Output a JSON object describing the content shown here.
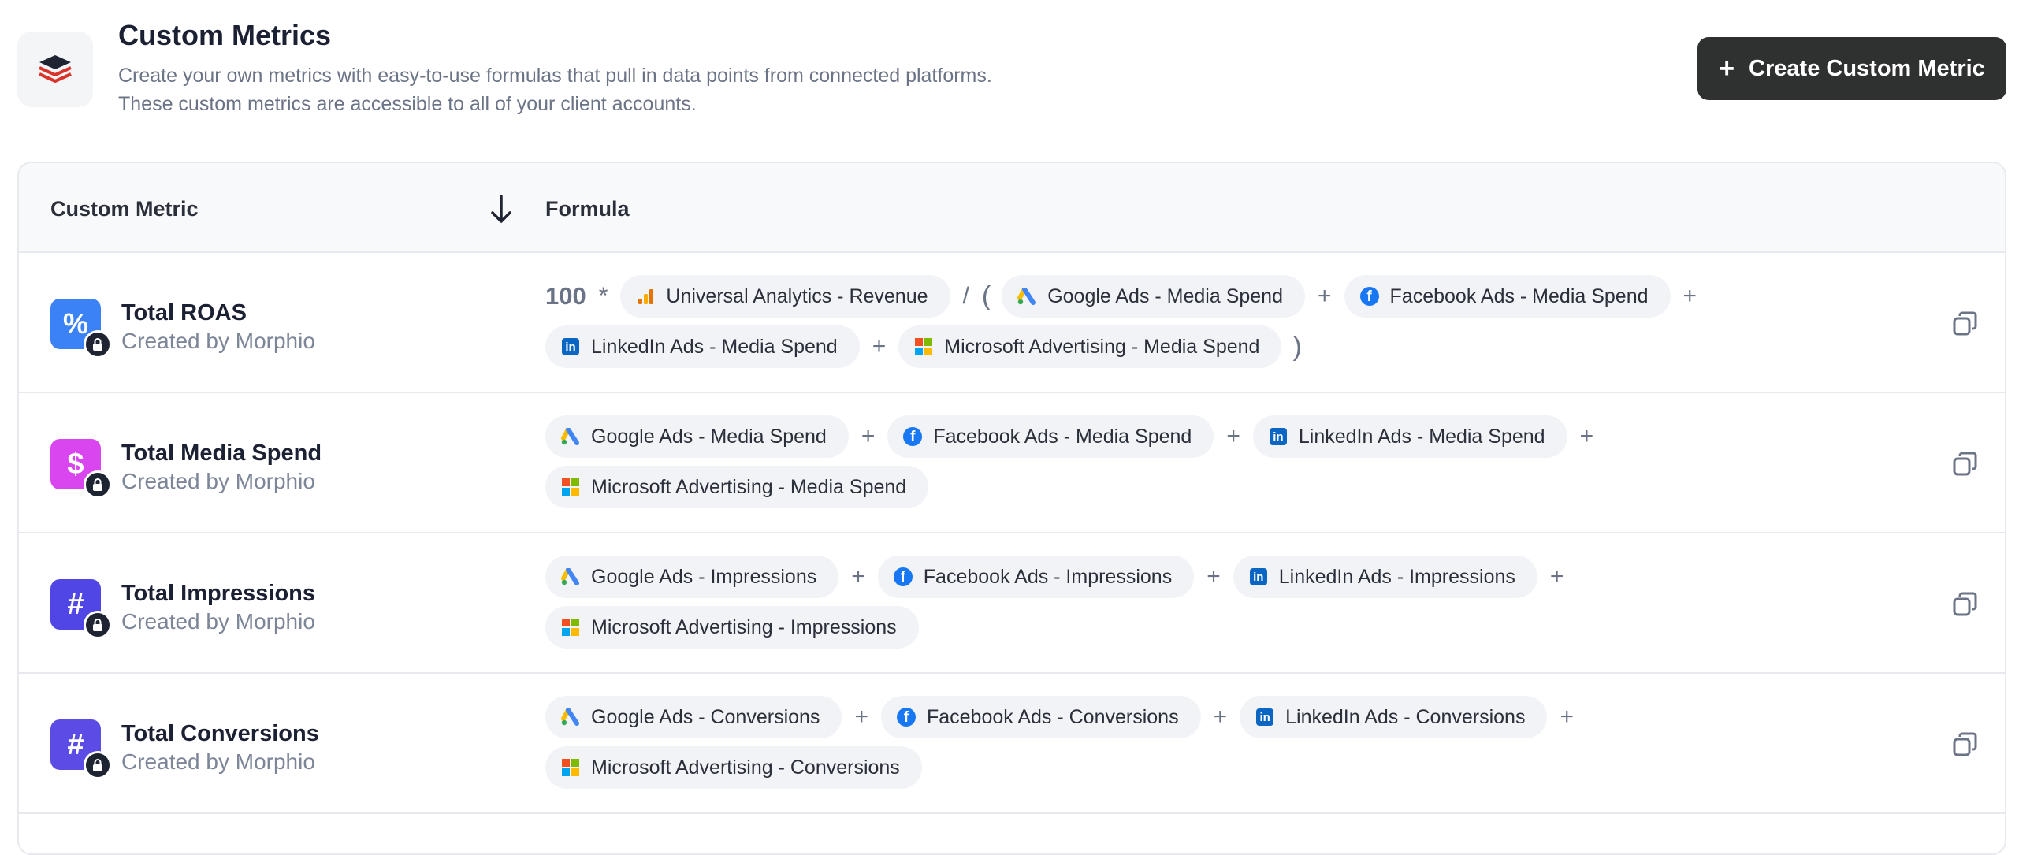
{
  "header": {
    "title": "Custom Metrics",
    "desc_line1": "Create your own metrics with easy-to-use formulas that pull in data points from connected platforms.",
    "desc_line2": "These custom metrics are accessible to all of your client accounts.",
    "create_button": "Create Custom Metric"
  },
  "table": {
    "col_metric": "Custom Metric",
    "col_formula": "Formula",
    "sort_icon": "arrow-down-icon"
  },
  "colors": {
    "roas_icon": "#3b82f6",
    "spend_icon": "#d946ef",
    "impressions_icon": "#4f46e5",
    "conversions_icon": "#5b4ce6",
    "button_bg": "#2f3030"
  },
  "rows": [
    {
      "name": "Total ROAS",
      "author": "Created by Morphio",
      "icon": "percent-icon",
      "prefix_number": "100",
      "prefix_operator": "*",
      "chip1": "Universal Analytics - Revenue",
      "divide": "/",
      "open_paren": "(",
      "chip2": "Google Ads - Media Spend",
      "plus1": "+",
      "chip3": "Facebook Ads - Media Spend",
      "plus2": "+",
      "chip4": "LinkedIn Ads - Media Spend",
      "plus3": "+",
      "chip5": "Microsoft Advertising - Media Spend",
      "close_paren": ")"
    },
    {
      "name": "Total Media Spend",
      "author": "Created by Morphio",
      "icon": "dollar-icon",
      "chip1": "Google Ads - Media Spend",
      "plus1": "+",
      "chip2": "Facebook Ads - Media Spend",
      "plus2": "+",
      "chip3": "LinkedIn Ads - Media Spend",
      "plus3": "+",
      "chip4": "Microsoft Advertising - Media Spend"
    },
    {
      "name": "Total Impressions",
      "author": "Created by Morphio",
      "icon": "hash-icon",
      "chip1": "Google Ads - Impressions",
      "plus1": "+",
      "chip2": "Facebook Ads - Impressions",
      "plus2": "+",
      "chip3": "LinkedIn Ads - Impressions",
      "plus3": "+",
      "chip4": "Microsoft Advertising - Impressions"
    },
    {
      "name": "Total Conversions",
      "author": "Created by Morphio",
      "icon": "hash-icon",
      "chip1": "Google Ads - Conversions",
      "plus1": "+",
      "chip2": "Facebook Ads - Conversions",
      "plus2": "+",
      "chip3": "LinkedIn Ads - Conversions",
      "plus3": "+",
      "chip4": "Microsoft Advertising - Conversions"
    }
  ]
}
